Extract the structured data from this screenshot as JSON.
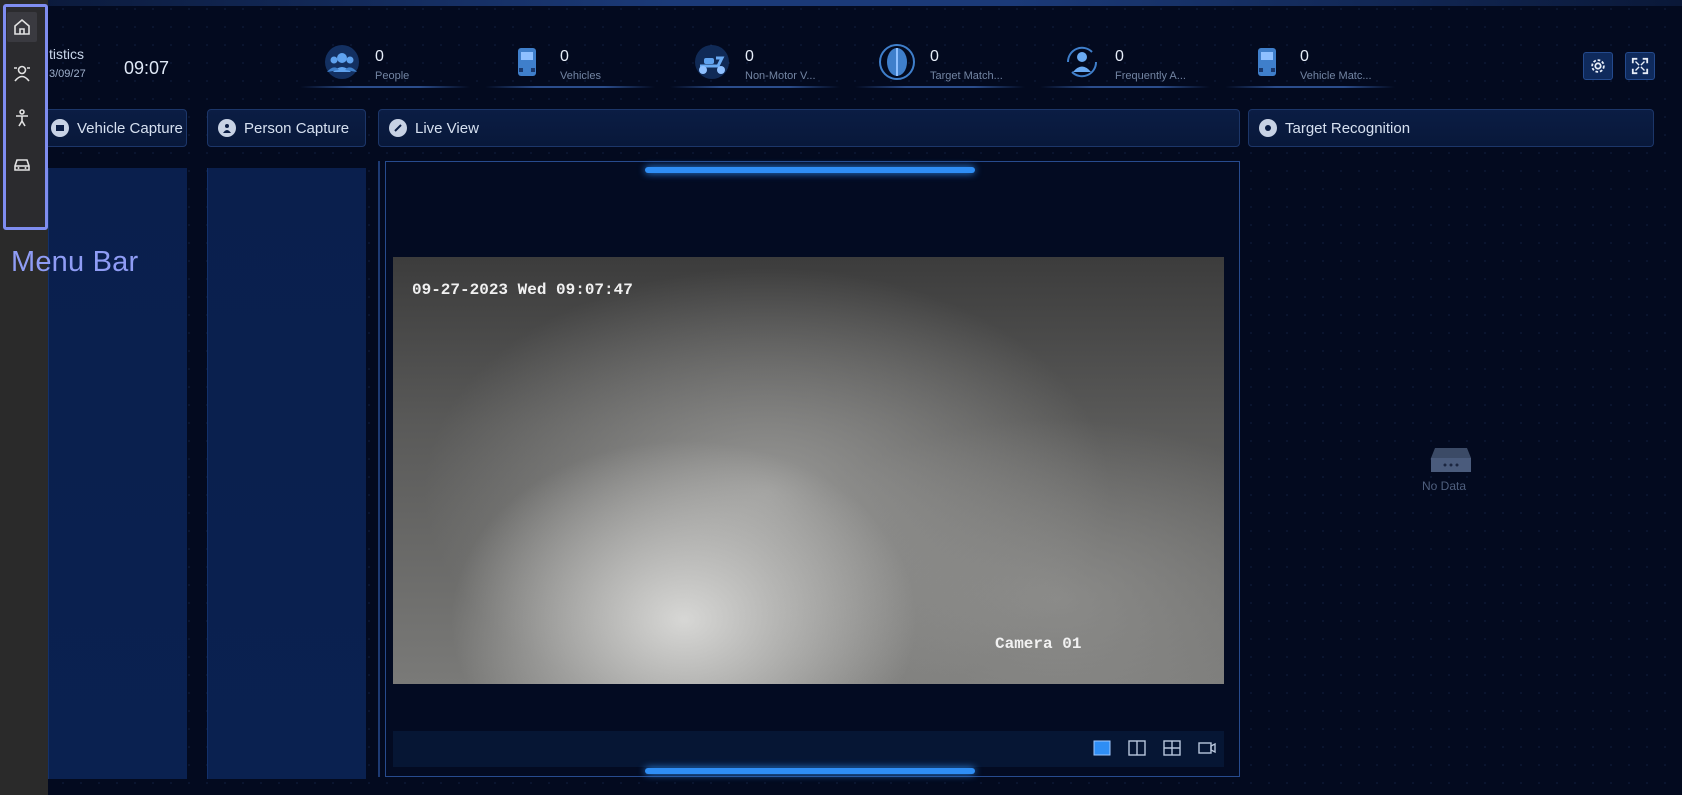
{
  "menu": {
    "items": [
      {
        "name": "home-icon",
        "active": true
      },
      {
        "name": "person-recognition-icon",
        "active": false
      },
      {
        "name": "pedestrian-icon",
        "active": false
      },
      {
        "name": "vehicle-icon",
        "active": false
      }
    ],
    "annotation": "Menu Bar",
    "highlight_color": "#7f8df0"
  },
  "header": {
    "title": "tistics",
    "date": "3/09/27",
    "time": "09:07"
  },
  "stats": [
    {
      "icon": "people-icon",
      "count": "0",
      "label": "People"
    },
    {
      "icon": "vehicles-icon",
      "count": "0",
      "label": "Vehicles"
    },
    {
      "icon": "scooter-icon",
      "count": "0",
      "label": "Non-Motor V..."
    },
    {
      "icon": "target-match-icon",
      "count": "0",
      "label": "Target Match..."
    },
    {
      "icon": "frequent-person-icon",
      "count": "0",
      "label": "Frequently A..."
    },
    {
      "icon": "vehicle-match-icon",
      "count": "0",
      "label": "Vehicle Matc..."
    }
  ],
  "toolbar": {
    "settings": "gear-icon",
    "fullscreen": "fullscreen-icon"
  },
  "panels": {
    "vehicle_capture": "Vehicle Capture",
    "person_capture": "Person Capture",
    "live_view": "Live View",
    "target_recognition": "Target Recognition"
  },
  "video": {
    "timestamp": "09-27-2023 Wed 09:07:47",
    "camera": "Camera 01"
  },
  "layouts": [
    "single-view-icon",
    "split-2-icon",
    "split-4-icon",
    "camera-icon"
  ],
  "target_recognition": {
    "empty_text": "No Data"
  },
  "colors": {
    "accent": "#2f8ef5",
    "background": "#030a1f",
    "panel": "#0a1f4d"
  }
}
